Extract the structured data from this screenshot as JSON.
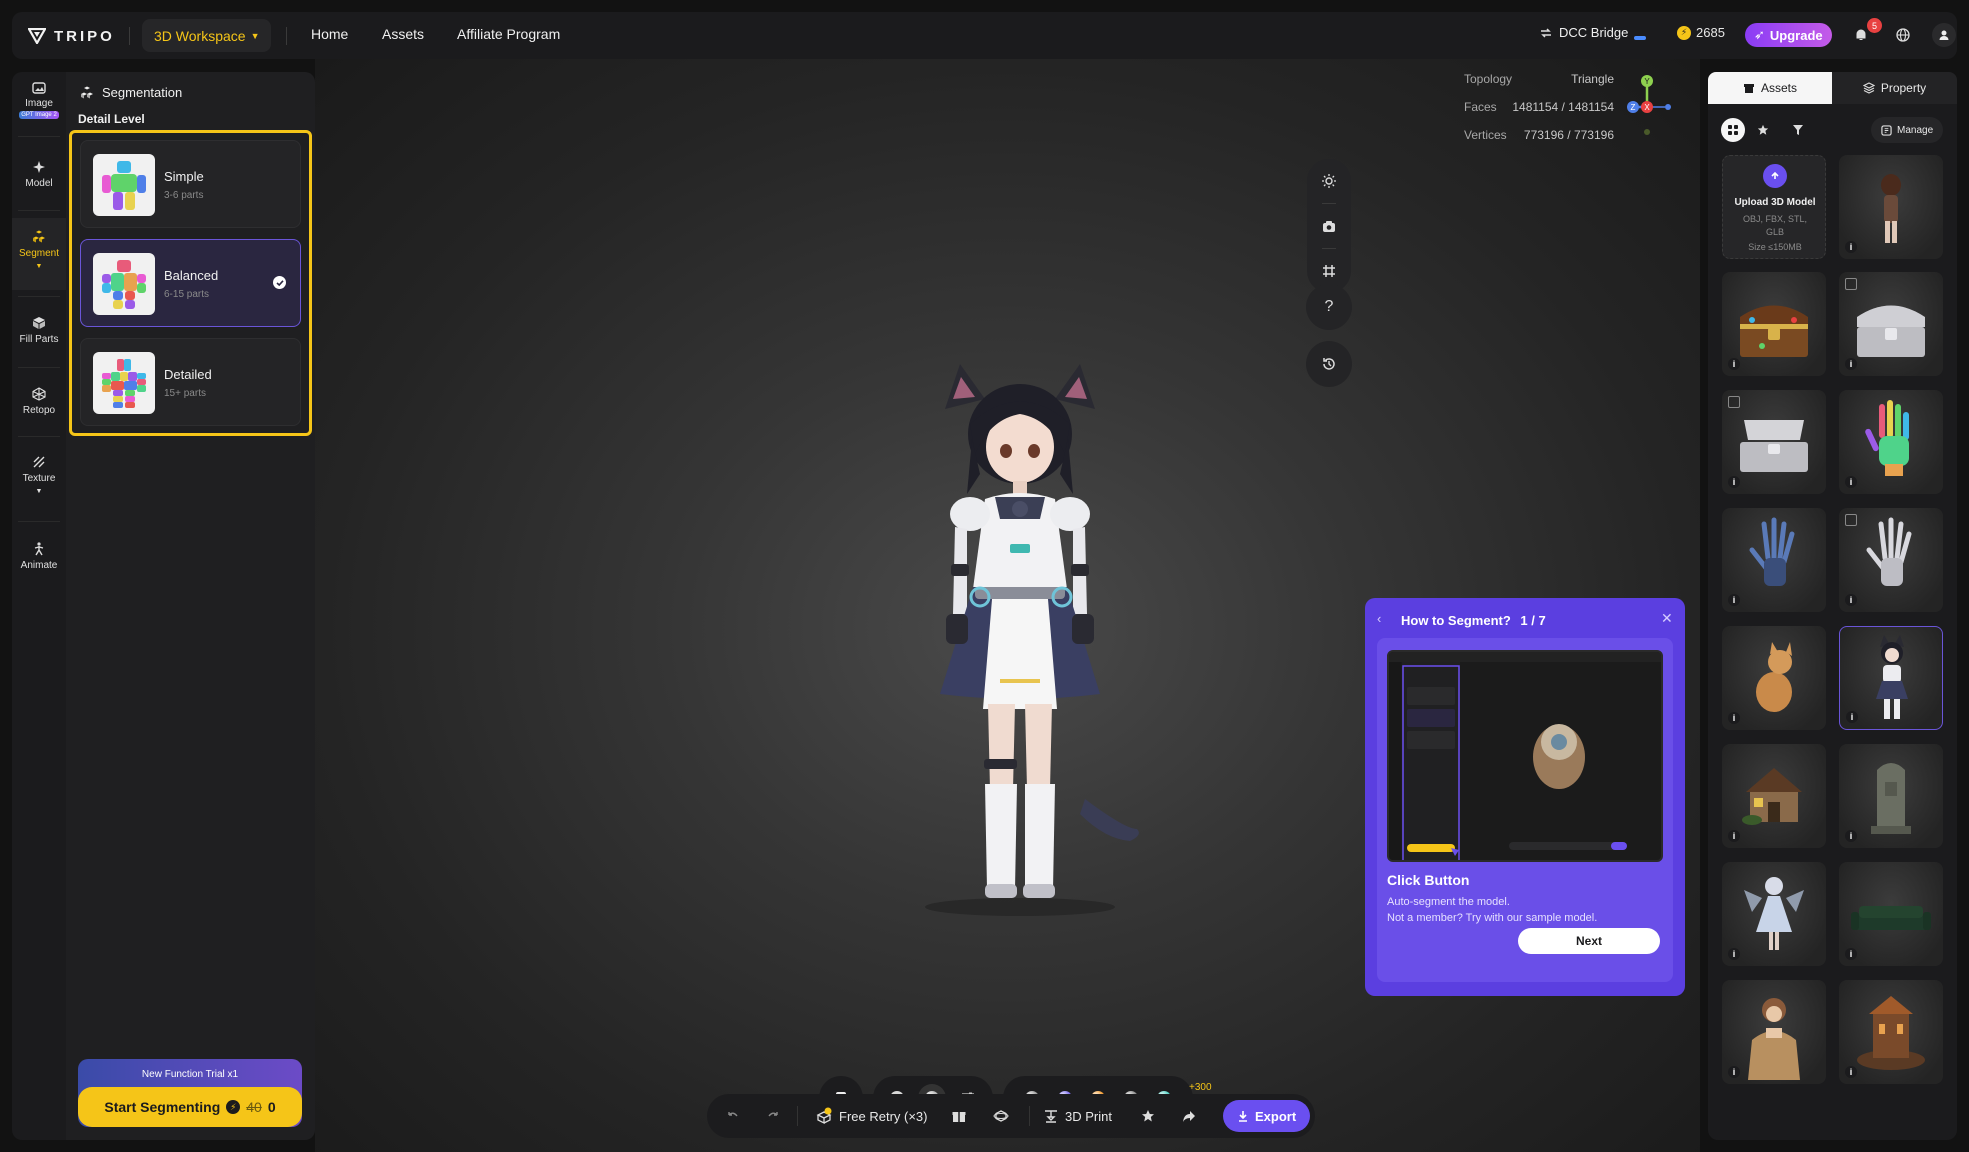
{
  "header": {
    "brand": "TRIPO",
    "workspace": "3D Workspace",
    "nav": [
      "Home",
      "Assets",
      "Affiliate Program"
    ],
    "dcc_bridge": "DCC Bridge",
    "credits": "2685",
    "upgrade": "Upgrade",
    "notifications": "5"
  },
  "rail": [
    {
      "label": "Image",
      "badge": "GPT Image 2"
    },
    {
      "label": "Model"
    },
    {
      "label": "Segment"
    },
    {
      "label": "Fill Parts"
    },
    {
      "label": "Retopo"
    },
    {
      "label": "Texture"
    },
    {
      "label": "Animate"
    }
  ],
  "panel": {
    "title": "Segmentation",
    "subtitle": "Detail Level",
    "options": [
      {
        "name": "Simple",
        "desc": "3-6 parts"
      },
      {
        "name": "Balanced",
        "desc": "6-15 parts"
      },
      {
        "name": "Detailed",
        "desc": "15+ parts"
      }
    ],
    "selected_option": "Balanced",
    "trial": "New Function Trial x1",
    "start": "Start Segmenting",
    "price_old": "40",
    "price_new": "0"
  },
  "stats": {
    "topology_label": "Topology",
    "topology": "Triangle",
    "faces_label": "Faces",
    "faces": "1481154 / 1481154",
    "vertices_label": "Vertices",
    "vertices": "773196 / 773196"
  },
  "axes": {
    "y": "Y",
    "x": "X",
    "z": "Z"
  },
  "viewport_tools": {
    "help": "?"
  },
  "tutorial": {
    "title": "How to Segment?",
    "step": "1 / 7",
    "heading": "Click Button",
    "line1": "Auto-segment the model.",
    "line2": "Not a member? Try with our sample model.",
    "next": "Next"
  },
  "actions": {
    "free_retry": "Free Retry (×3)",
    "print": "3D Print",
    "share_bonus": "+300",
    "export": "Export"
  },
  "material_dots": [
    "#9a9a9a",
    "#7b6cf0",
    "#f29a2e",
    "#8a8a8a",
    "#4fd1c5"
  ],
  "assets": {
    "tab_assets": "Assets",
    "tab_property": "Property",
    "manage": "Manage",
    "upload_title": "Upload 3D Model",
    "upload_formats": "OBJ, FBX, STL, GLB",
    "upload_size": "Size ≤150MB",
    "info": "i"
  },
  "colors": {
    "accent": "#f5c518",
    "primary": "#6a4ff0",
    "tutorial": "#5b3fe0"
  }
}
